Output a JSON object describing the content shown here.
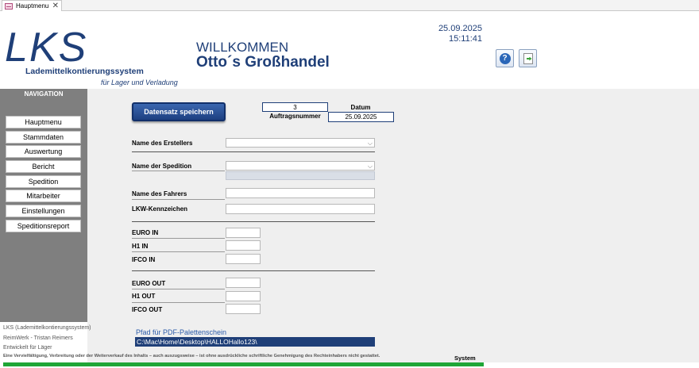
{
  "tab": {
    "label": "Hauptmenu",
    "close": "✕"
  },
  "header": {
    "logo": "LKS",
    "logo_subtitle": "Lademittelkontierungssystem",
    "logo_tagline": "für Lager und Verladung",
    "welcome": "WILLKOMMEN",
    "company": "Otto´s Großhandel",
    "date": "25.09.2025",
    "time": "15:11:41",
    "help_glyph": "?",
    "icons": {
      "help": "help-icon",
      "exit": "exit-icon"
    }
  },
  "sidebar": {
    "title": "NAVIGATION",
    "items": [
      {
        "label": "Hauptmenu"
      },
      {
        "label": "Stammdaten"
      },
      {
        "label": "Auswertung"
      },
      {
        "label": "Bericht"
      },
      {
        "label": "Spedition"
      },
      {
        "label": "Mitarbeiter"
      },
      {
        "label": "Einstellungen"
      },
      {
        "label": "Speditionsreport"
      }
    ]
  },
  "form": {
    "save_label": "Datensatz speichern",
    "order_number": "3",
    "order_number_label": "Auftragsnummer",
    "date_label": "Datum",
    "date_value": "25.09.2025",
    "creator_label": "Name des Erstellers",
    "creator_value": "",
    "carrier_label": "Name der Spedition",
    "carrier_value": "",
    "driver_label": "Name des Fahrers",
    "driver_value": "",
    "plate_label": "LKW-Kennzeichen",
    "plate_value": "",
    "in_fields": [
      {
        "label": "EURO IN",
        "value": ""
      },
      {
        "label": "H1 IN",
        "value": ""
      },
      {
        "label": "IFCO IN",
        "value": ""
      }
    ],
    "out_fields": [
      {
        "label": "EURO OUT",
        "value": ""
      },
      {
        "label": "H1 OUT",
        "value": ""
      },
      {
        "label": "IFCO OUT",
        "value": ""
      }
    ],
    "pdf_label": "Pfad für PDF-Palettenschein",
    "pdf_path": "C:\\Mac\\Home\\Desktop\\HALLOHallo123\\",
    "combo_arrow": "⌵"
  },
  "footer": {
    "line1": "LKS (Lademittelkontierungssystem)",
    "line2": "ReimWerk - Tristan Reimers",
    "line3": "Entwickelt für Läger",
    "copyright": "Eine Vervielfältigung, Verbreitung oder der Weiterverkauf des Inhalts – auch auszugsweise – ist ohne ausdrückliche schriftliche Genehmigung des Rechteinhabers nicht gestattet.",
    "system_label": "System",
    "progress": 1.0
  },
  "colors": {
    "brand": "#1f3f78",
    "nav_bg": "#7f7f7f",
    "panel_bg": "#efefef",
    "progress": "#1fa637"
  }
}
